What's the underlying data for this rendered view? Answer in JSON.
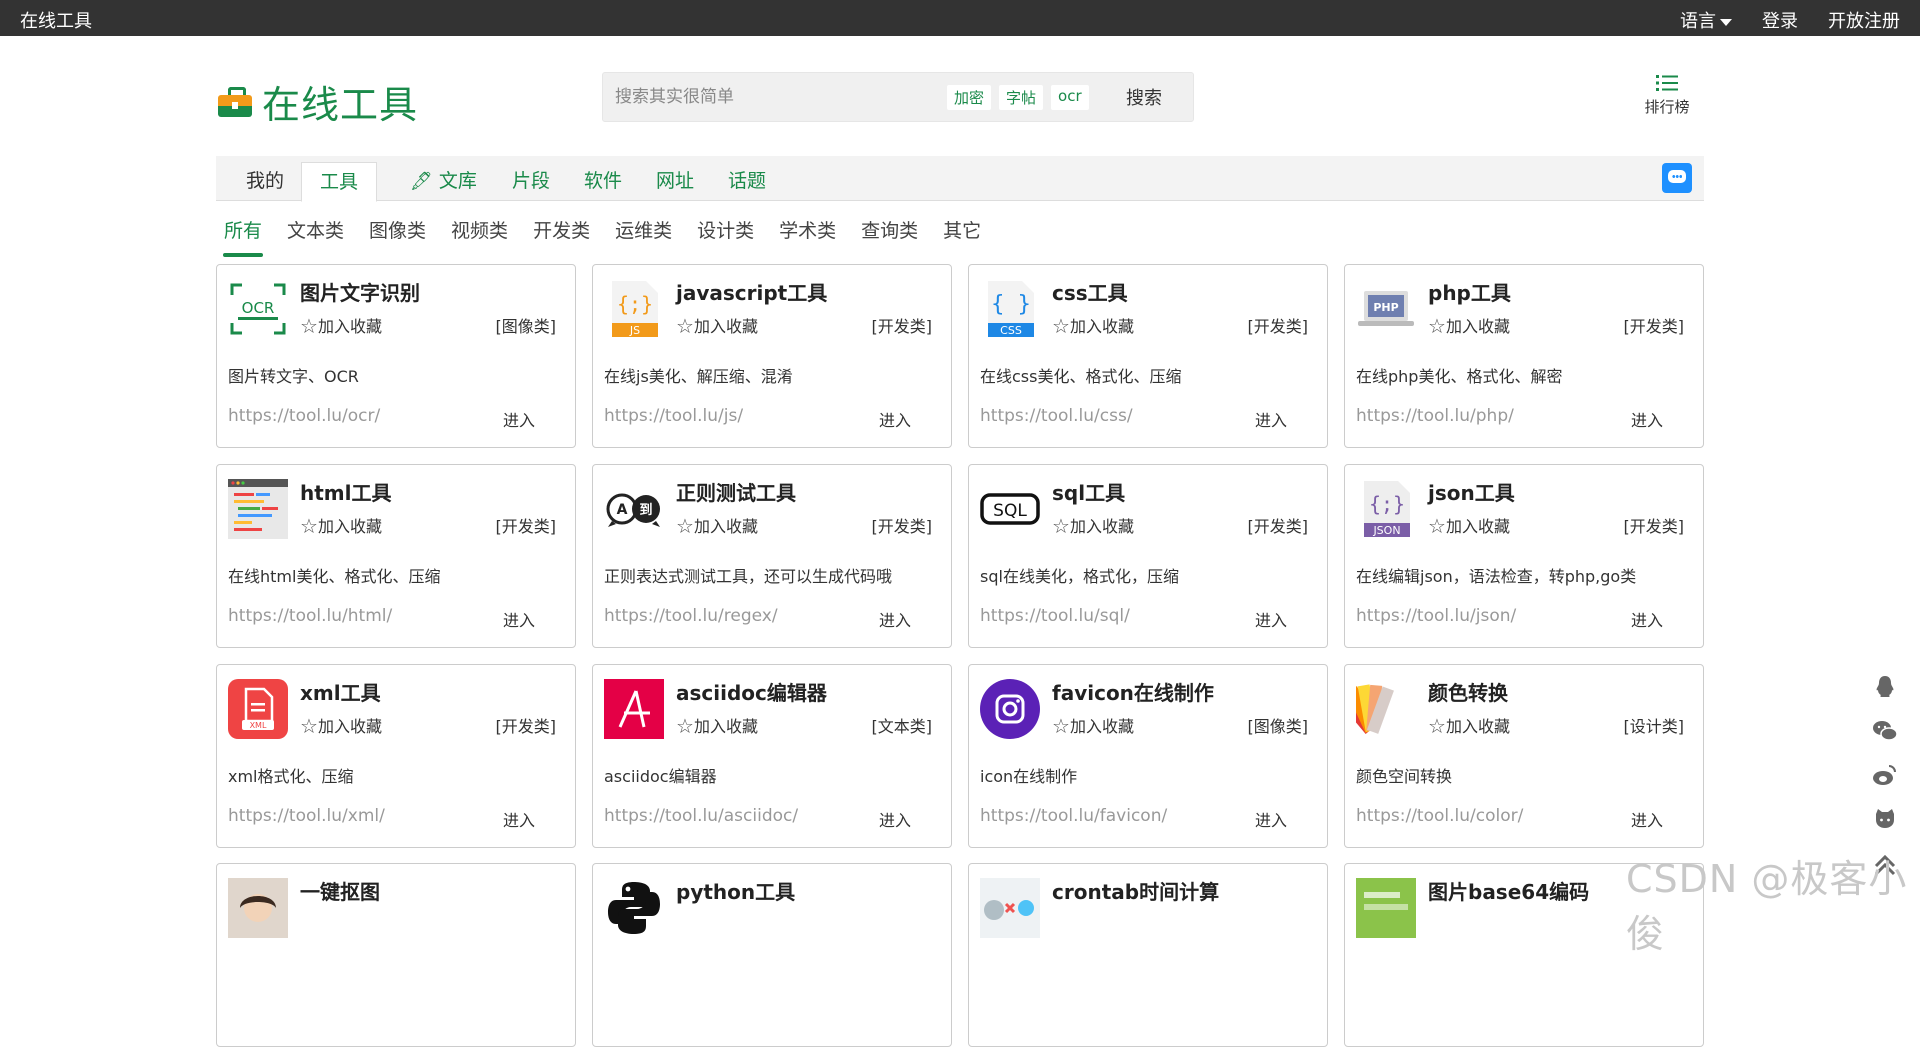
{
  "topbar": {
    "brand": "在线工具",
    "language": "语言",
    "login": "登录",
    "register": "开放注册"
  },
  "header": {
    "logo_text": "在线工具",
    "search": {
      "placeholder": "搜索其实很简单",
      "tags": [
        "加密",
        "字帖",
        "ocr"
      ],
      "button": "搜索"
    },
    "rank_label": "排行榜"
  },
  "nav": {
    "tabs": [
      "我的",
      "工具",
      "文库",
      "片段",
      "软件",
      "网址",
      "话题"
    ],
    "active": "工具"
  },
  "categories": {
    "items": [
      "所有",
      "文本类",
      "图像类",
      "视频类",
      "开发类",
      "运维类",
      "设计类",
      "学术类",
      "查询类",
      "其它"
    ],
    "active": "所有"
  },
  "favorite_label": "加入收藏",
  "enter_label": "进入",
  "cards": [
    {
      "name": "图片文字识别",
      "category": "[图像类]",
      "desc": "图片转文字、OCR",
      "url": "https://tool.lu/ocr/",
      "icon": "ocr-icon"
    },
    {
      "name": "javascript工具",
      "category": "[开发类]",
      "desc": "在线js美化、解压缩、混淆",
      "url": "https://tool.lu/js/",
      "icon": "js-file-icon"
    },
    {
      "name": "css工具",
      "category": "[开发类]",
      "desc": "在线css美化、格式化、压缩",
      "url": "https://tool.lu/css/",
      "icon": "css-file-icon"
    },
    {
      "name": "php工具",
      "category": "[开发类]",
      "desc": "在线php美化、格式化、解密",
      "url": "https://tool.lu/php/",
      "icon": "php-laptop-icon"
    },
    {
      "name": "html工具",
      "category": "[开发类]",
      "desc": "在线html美化、格式化、压缩",
      "url": "https://tool.lu/html/",
      "icon": "html-editor-icon"
    },
    {
      "name": "正则测试工具",
      "category": "[开发类]",
      "desc": "正则表达式测试工具，还可以生成代码哦",
      "url": "https://tool.lu/regex/",
      "icon": "regex-bubbles-icon"
    },
    {
      "name": "sql工具",
      "category": "[开发类]",
      "desc": "sql在线美化，格式化，压缩",
      "url": "https://tool.lu/sql/",
      "icon": "sql-icon"
    },
    {
      "name": "json工具",
      "category": "[开发类]",
      "desc": "在线编辑json，语法检查，转php,go类",
      "url": "https://tool.lu/json/",
      "icon": "json-file-icon"
    },
    {
      "name": "xml工具",
      "category": "[开发类]",
      "desc": "xml格式化、压缩",
      "url": "https://tool.lu/xml/",
      "icon": "xml-file-icon"
    },
    {
      "name": "asciidoc编辑器",
      "category": "[文本类]",
      "desc": "asciidoc编辑器",
      "url": "https://tool.lu/asciidoc/",
      "icon": "asciidoc-icon"
    },
    {
      "name": "favicon在线制作",
      "category": "[图像类]",
      "desc": "icon在线制作",
      "url": "https://tool.lu/favicon/",
      "icon": "camera-circle-icon"
    },
    {
      "name": "颜色转换",
      "category": "[设计类]",
      "desc": "颜色空间转换",
      "url": "https://tool.lu/color/",
      "icon": "color-swatch-icon"
    },
    {
      "name": "一键抠图",
      "category": "",
      "desc": "",
      "url": "",
      "icon": "portrait-icon"
    },
    {
      "name": "python工具",
      "category": "",
      "desc": "",
      "url": "",
      "icon": "python-icon"
    },
    {
      "name": "crontab时间计算",
      "category": "",
      "desc": "",
      "url": "",
      "icon": "crontab-icon"
    },
    {
      "name": "图片base64编码",
      "category": "",
      "desc": "",
      "url": "",
      "icon": "base64-image-icon"
    }
  ],
  "float_icons": [
    "qq-icon",
    "wechat-icon",
    "weibo-icon",
    "github-icon",
    "back-to-top-icon"
  ],
  "watermark": "CSDN @极客小俊",
  "colors": {
    "brand_green": "#1a8a4a",
    "topbar": "#333333",
    "chat_blue": "#1e90ff"
  }
}
